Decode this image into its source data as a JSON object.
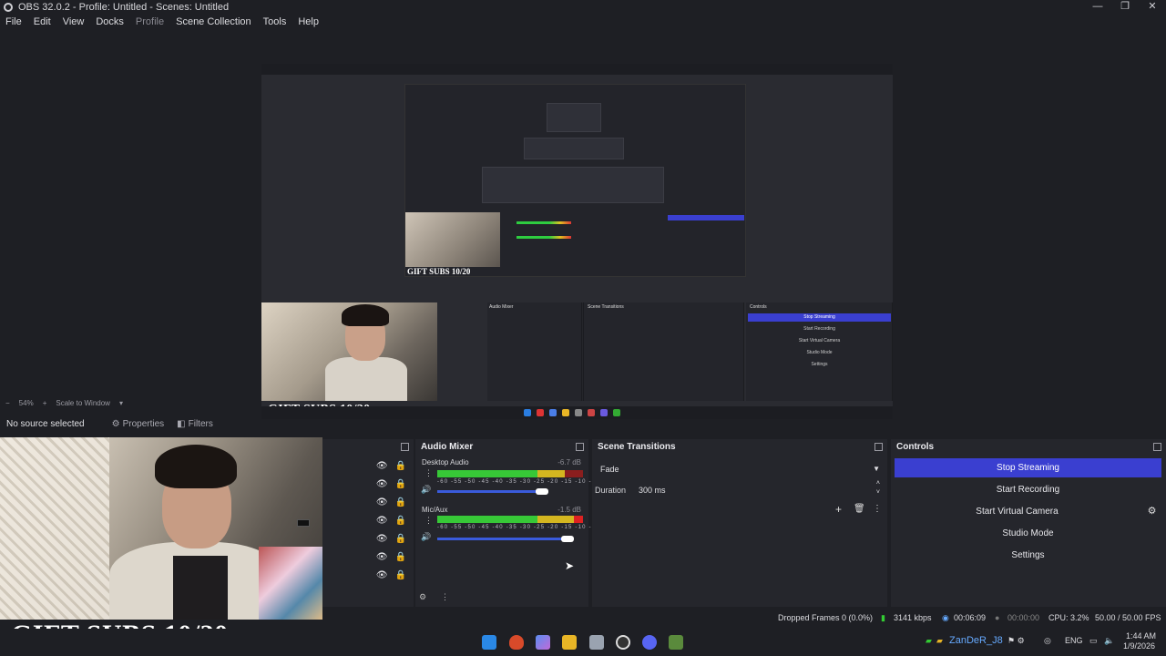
{
  "window": {
    "title": "OBS 32.0.2 - Profile: Untitled - Scenes: Untitled",
    "controls": [
      "—",
      "❐",
      "✕"
    ]
  },
  "menu": [
    "File",
    "Edit",
    "View",
    "Docks",
    "Profile",
    "Scene Collection",
    "Tools",
    "Help"
  ],
  "preview": {
    "zoom": "54%",
    "scale_mode": "Scale to Window",
    "overlay_text": "GIFT SUBS 10/20"
  },
  "source_toolbar": {
    "no_source": "No source selected",
    "properties": "Properties",
    "filters": "Filters"
  },
  "audio_mixer": {
    "title": "Audio Mixer",
    "channels": [
      {
        "name": "Desktop Audio",
        "db": "-6.7 dB",
        "level": 0.92
      },
      {
        "name": "Mic/Aux",
        "db": "-1.5 dB",
        "level": 0.98
      }
    ],
    "scale": "-60 -55 -50 -45 -40 -35 -30 -25 -20 -15 -10 -5 0"
  },
  "scene_transitions": {
    "title": "Scene Transitions",
    "transition": "Fade",
    "duration_label": "Duration",
    "duration_value": "300 ms"
  },
  "controls": {
    "title": "Controls",
    "buttons": [
      "Stop Streaming",
      "Start Recording",
      "Start Virtual Camera",
      "Studio Mode",
      "Settings"
    ]
  },
  "status": {
    "dropped_frames": "Dropped Frames 0 (0.0%)",
    "bitrate": "3141 kbps",
    "stream_time": "00:06:09",
    "record_time": "00:00:00",
    "cpu": "CPU: 3.2%",
    "fps": "50.00 / 50.00 FPS"
  },
  "taskbar": {
    "username": "ZanDeR_J8",
    "lang": "ENG",
    "time": "1:44 AM",
    "date": "1/9/2026"
  },
  "colors": {
    "accent": "#3a3fd0",
    "bg": "#1e1f24",
    "panel": "#25262c"
  }
}
